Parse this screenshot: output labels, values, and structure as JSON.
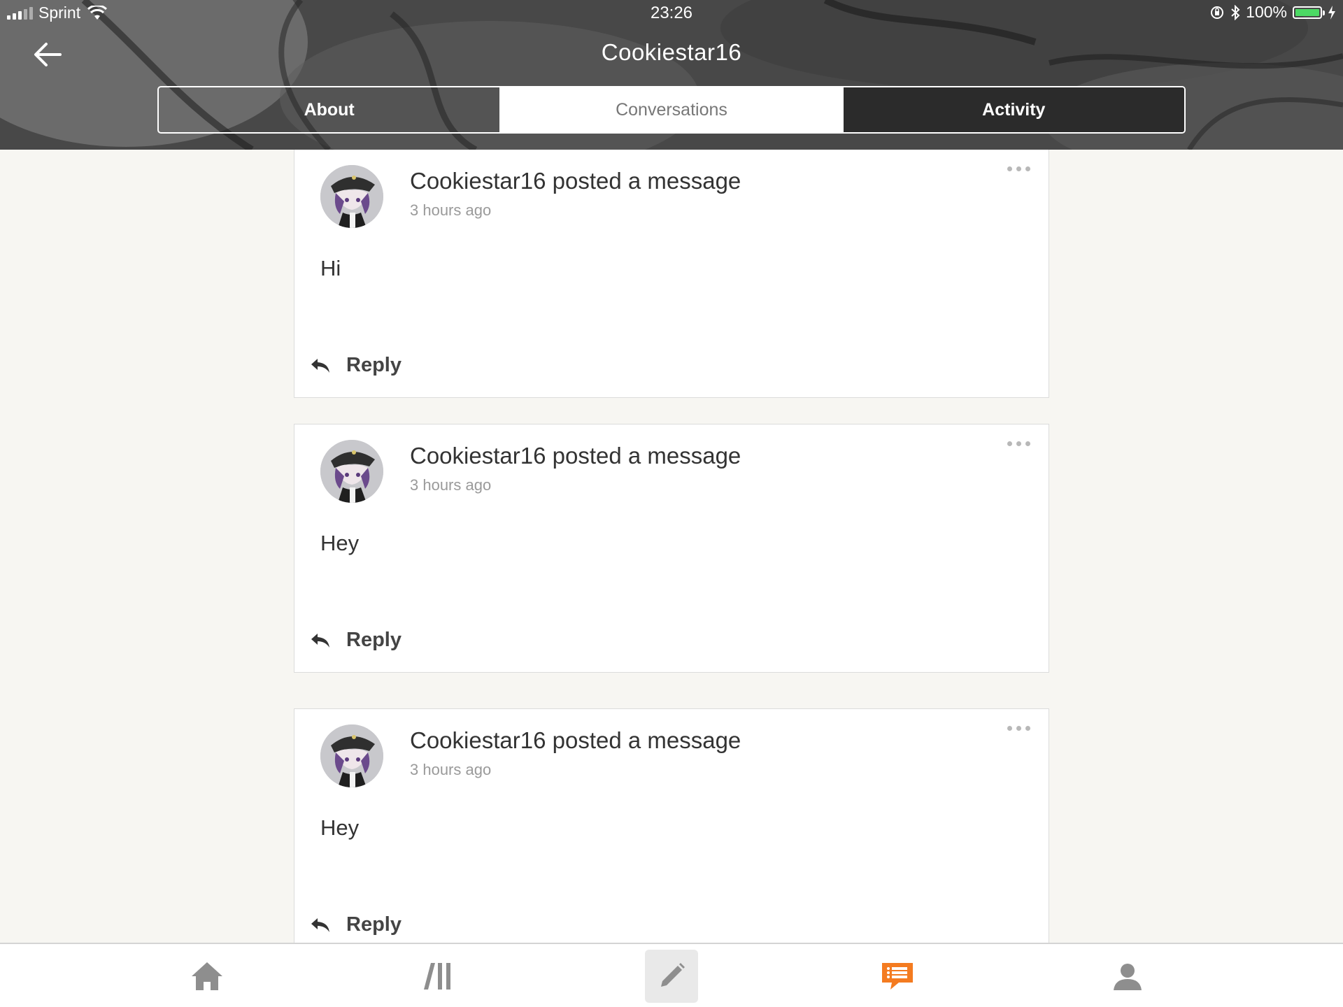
{
  "status_bar": {
    "carrier": "Sprint",
    "time": "23:26",
    "battery": "100%",
    "battery_level": 1.0
  },
  "header": {
    "title": "Cookiestar16",
    "back_icon": "arrow-left-icon"
  },
  "tabs": [
    {
      "label": "About",
      "active": false
    },
    {
      "label": "Conversations",
      "active": true
    },
    {
      "label": "Activity",
      "active": false
    }
  ],
  "posts": [
    {
      "title": "Cookiestar16 posted a message",
      "time": "3 hours ago",
      "body": "Hi",
      "reply_label": "Reply"
    },
    {
      "title": "Cookiestar16 posted a message",
      "time": "3 hours ago",
      "body": "Hey",
      "reply_label": "Reply"
    },
    {
      "title": "Cookiestar16 posted a message",
      "time": "3 hours ago",
      "body": "Hey",
      "reply_label": "Reply"
    }
  ],
  "bottom_nav": {
    "items": [
      "home-icon",
      "library-icon",
      "compose-pencil-icon",
      "messages-icon",
      "profile-icon"
    ],
    "active": "messages-icon",
    "accent_color": "#f47b20"
  }
}
